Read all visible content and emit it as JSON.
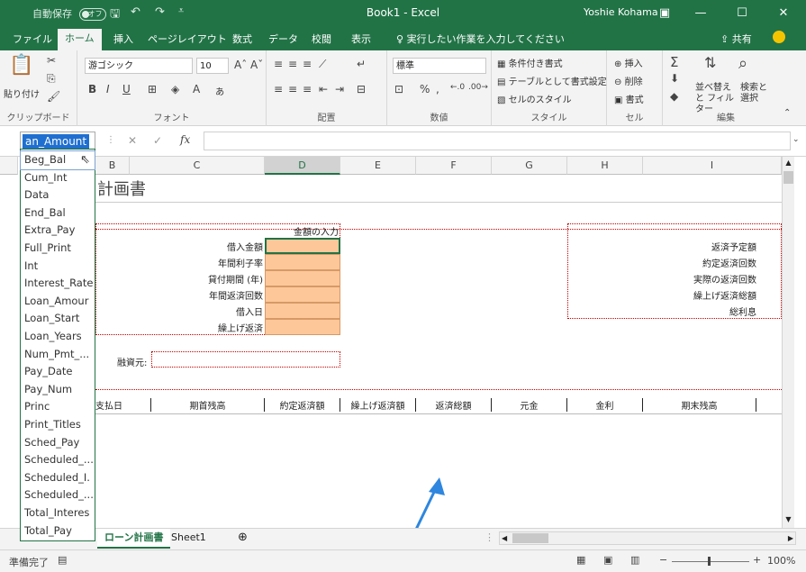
{
  "titlebar": {
    "autosave_label": "自動保存",
    "autosave_state": "オフ",
    "title": "Book1 - Excel",
    "user": "Yoshie Kohama"
  },
  "tabs": [
    "ファイル",
    "ホーム",
    "挿入",
    "ページレイアウト",
    "数式",
    "データ",
    "校閲",
    "表示"
  ],
  "active_tab": "ホーム",
  "search_hint": "実行したい作業を入力してください",
  "share_label": "共有",
  "ribbon": {
    "clipboard": {
      "paste": "貼り付け",
      "label": "クリップボード"
    },
    "font": {
      "name": "游ゴシック",
      "size": "10",
      "label": "フォント"
    },
    "align": {
      "label": "配置"
    },
    "number": {
      "format": "標準",
      "label": "数値"
    },
    "styles": {
      "conditional": "条件付き書式",
      "table": "テーブルとして書式設定",
      "cell": "セルのスタイル",
      "label": "スタイル"
    },
    "cells": {
      "insert": "挿入",
      "delete": "削除",
      "format": "書式",
      "label": "セル"
    },
    "editing": {
      "sort": "並べ替えと フィルター",
      "find": "検索と 選択",
      "label": "編集"
    }
  },
  "formula_bar": {
    "name_box": "an_Amount",
    "fx": "fx",
    "content": ""
  },
  "columns": [
    "B",
    "C",
    "D",
    "E",
    "F",
    "G",
    "H",
    "I"
  ],
  "selected_column": "D",
  "sheet": {
    "title": "計画書",
    "input_header": "金額の入力",
    "input_labels": [
      "借入金額",
      "年間利子率",
      "貸付期間 (年)",
      "年間返済回数",
      "借入日",
      "繰上げ返済"
    ],
    "right_labels": [
      "返済予定額",
      "約定返済回数",
      "実際の返済回数",
      "繰上げ返済総額",
      "総利息"
    ],
    "lender_label": "融資元:",
    "table_headers": [
      "支払日",
      "期首残高",
      "約定返済額",
      "繰上げ返済額",
      "返済総額",
      "元金",
      "金利",
      "期末残高"
    ]
  },
  "name_dropdown": {
    "items": [
      "Beg_Bal",
      "Cum_Int",
      "Data",
      "End_Bal",
      "Extra_Pay",
      "Full_Print",
      "Int",
      "Interest_Rate",
      "Loan_Amour",
      "Loan_Start",
      "Loan_Years",
      "Num_Pmt_...",
      "Pay_Date",
      "Pay_Num",
      "Princ",
      "Print_Titles",
      "Sched_Pay",
      "Scheduled_...",
      "Scheduled_I.",
      "Scheduled_...",
      "Total_Interes",
      "Total_Pay"
    ],
    "hovered_index": 0
  },
  "sheet_tabs": [
    "ローン計画書",
    "Sheet1"
  ],
  "active_sheet": "ローン計画書",
  "status": {
    "ready": "準備完了",
    "zoom": "100%"
  },
  "colors": {
    "excel_green": "#217346",
    "input_fill": "#fdc79a",
    "dotted_border": "#c00000",
    "annotation_arrow": "#2e86de"
  }
}
